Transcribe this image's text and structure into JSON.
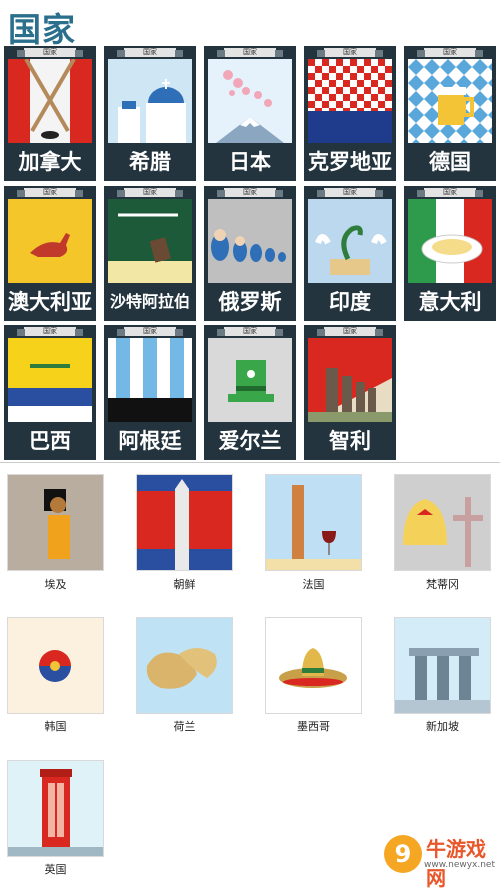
{
  "page": {
    "title": "国家"
  },
  "ribbon_text": "国家",
  "cards": [
    {
      "name": "加拿大"
    },
    {
      "name": "希腊"
    },
    {
      "name": "日本"
    },
    {
      "name": "克罗地亚"
    },
    {
      "name": "德国"
    },
    {
      "name": "澳大利亚"
    },
    {
      "name": "沙特阿拉伯"
    },
    {
      "name": "俄罗斯"
    },
    {
      "name": "印度"
    },
    {
      "name": "意大利"
    },
    {
      "name": "巴西"
    },
    {
      "name": "阿根廷"
    },
    {
      "name": "爱尔兰"
    },
    {
      "name": "智利"
    }
  ],
  "tiles": [
    {
      "name": "埃及"
    },
    {
      "name": "朝鲜"
    },
    {
      "name": "法国"
    },
    {
      "name": "梵蒂冈"
    },
    {
      "name": "韩国"
    },
    {
      "name": "荷兰"
    },
    {
      "name": "墨西哥"
    },
    {
      "name": "新加坡"
    },
    {
      "name": "英国"
    }
  ],
  "watermark": {
    "badge": "9",
    "title": "牛游戏网",
    "url": "www.newyx.net"
  },
  "colors": {
    "card_bg": "#23343f",
    "title": "#2a6f8c",
    "ribbon": "#e3e3e3"
  }
}
